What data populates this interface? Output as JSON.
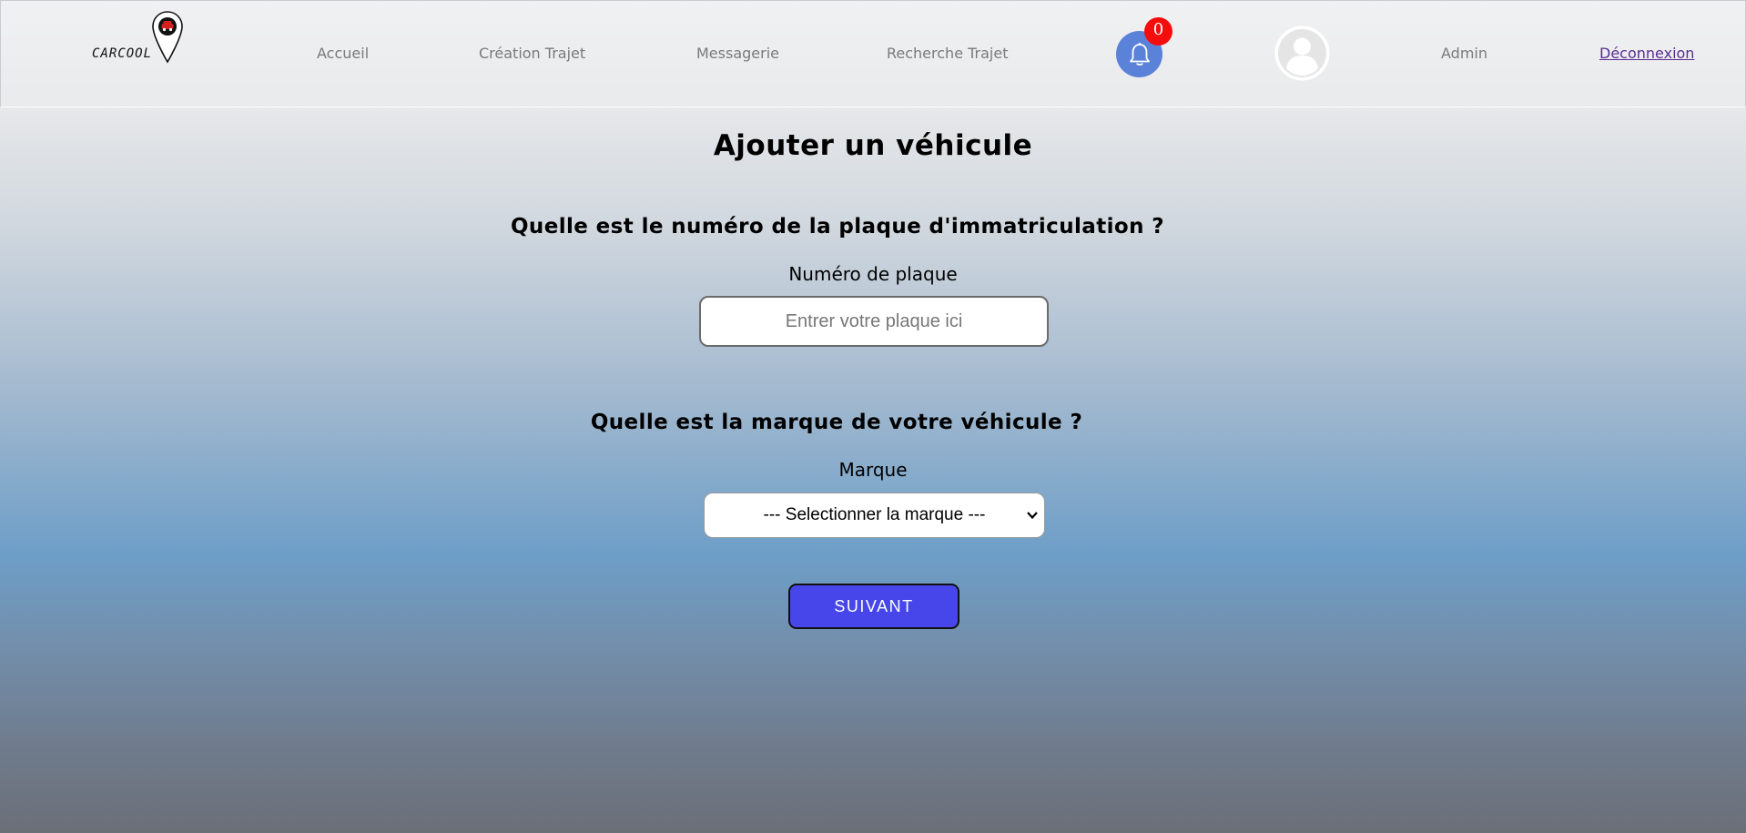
{
  "app": {
    "brand": "CARCOOL"
  },
  "nav": {
    "home": "Accueil",
    "create_trip": "Création Trajet",
    "messaging": "Messagerie",
    "search_trip": "Recherche Trajet",
    "notifications_count": "0",
    "admin": "Admin",
    "logout": "Déconnexion"
  },
  "page": {
    "title": "Ajouter un véhicule",
    "plate_question": "Quelle est le numéro de la plaque d'immatriculation ?",
    "plate_label": "Numéro de plaque",
    "plate_placeholder": "Entrer votre plaque ici",
    "plate_value": "",
    "brand_question": "Quelle est la marque de votre véhicule ?",
    "brand_label": "Marque",
    "brand_selected": "--- Selectionner la marque ---",
    "next_button": "SUIVANT"
  },
  "icons": {
    "logo": "location-pin-car-icon",
    "notifications": "bell-icon",
    "profile": "user-avatar-icon",
    "select": "chevron-down-icon"
  },
  "colors": {
    "accent_button": "#4646ea",
    "bell_bg": "#5b82d9",
    "badge": "#f50d0d",
    "logout_link": "#5a2d91"
  }
}
